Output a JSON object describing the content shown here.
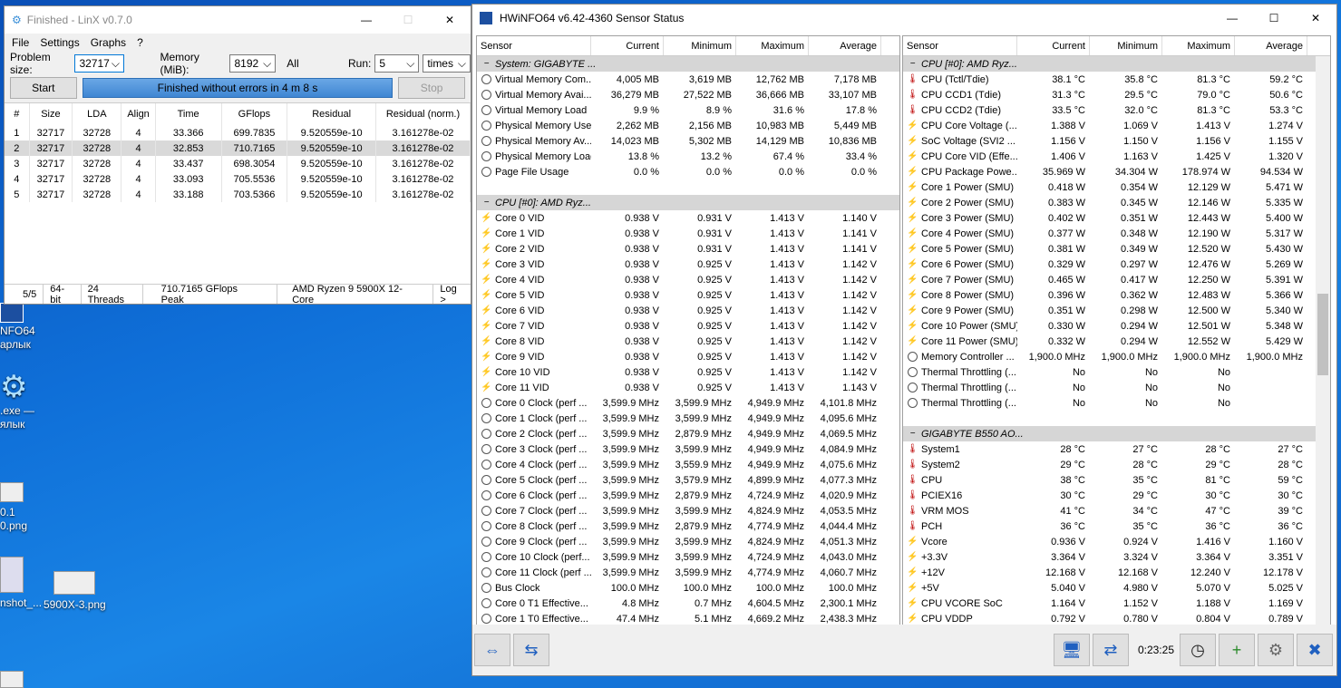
{
  "desktop": {
    "icons": [
      "NFO64",
      "арлык",
      ".exe —",
      "ялык",
      "0.1",
      "0.png",
      "nshot_...",
      "5900X-3.png"
    ]
  },
  "linx": {
    "title": "Finished - LinX v0.7.0",
    "menu": [
      "File",
      "Settings",
      "Graphs",
      "?"
    ],
    "problem_size_label": "Problem size:",
    "problem_size": "32717",
    "memory_label": "Memory (MiB):",
    "memory": "8192",
    "all_label": "All",
    "run_label": "Run:",
    "run": "5",
    "run_unit": "times",
    "start": "Start",
    "progress": "Finished without errors in 4 m 8 s",
    "stop": "Stop",
    "columns": [
      "#",
      "Size",
      "LDA",
      "Align",
      "Time",
      "GFlops",
      "Residual",
      "Residual (norm.)"
    ],
    "rows": [
      [
        "1",
        "32717",
        "32728",
        "4",
        "33.366",
        "699.7835",
        "9.520559e-10",
        "3.161278e-02"
      ],
      [
        "2",
        "32717",
        "32728",
        "4",
        "32.853",
        "710.7165",
        "9.520559e-10",
        "3.161278e-02"
      ],
      [
        "3",
        "32717",
        "32728",
        "4",
        "33.437",
        "698.3054",
        "9.520559e-10",
        "3.161278e-02"
      ],
      [
        "4",
        "32717",
        "32728",
        "4",
        "33.093",
        "705.5536",
        "9.520559e-10",
        "3.161278e-02"
      ],
      [
        "5",
        "32717",
        "32728",
        "4",
        "33.188",
        "703.5366",
        "9.520559e-10",
        "3.161278e-02"
      ]
    ],
    "status": [
      "5/5",
      "64-bit",
      "24 Threads",
      "710.7165 GFlops Peak",
      "AMD Ryzen 9 5900X 12-Core",
      "Log >"
    ]
  },
  "hw": {
    "title": "HWiNFO64 v6.42-4360 Sensor Status",
    "columns": [
      "Sensor",
      "Current",
      "Minimum",
      "Maximum",
      "Average"
    ],
    "left": [
      {
        "g": "System: GIGABYTE ..."
      },
      {
        "i": "clk",
        "n": "Virtual Memory Com...",
        "v": [
          "4,005 MB",
          "3,619 MB",
          "12,762 MB",
          "7,178 MB"
        ]
      },
      {
        "i": "clk",
        "n": "Virtual Memory Avai...",
        "v": [
          "36,279 MB",
          "27,522 MB",
          "36,666 MB",
          "33,107 MB"
        ]
      },
      {
        "i": "clk",
        "n": "Virtual Memory Load",
        "v": [
          "9.9 %",
          "8.9 %",
          "31.6 %",
          "17.8 %"
        ]
      },
      {
        "i": "clk",
        "n": "Physical Memory Used",
        "v": [
          "2,262 MB",
          "2,156 MB",
          "10,983 MB",
          "5,449 MB"
        ]
      },
      {
        "i": "clk",
        "n": "Physical Memory Av...",
        "v": [
          "14,023 MB",
          "5,302 MB",
          "14,129 MB",
          "10,836 MB"
        ]
      },
      {
        "i": "clk",
        "n": "Physical Memory Load",
        "v": [
          "13.8 %",
          "13.2 %",
          "67.4 %",
          "33.4 %"
        ]
      },
      {
        "i": "clk",
        "n": "Page File Usage",
        "v": [
          "0.0 %",
          "0.0 %",
          "0.0 %",
          "0.0 %"
        ]
      },
      {
        "blank": true
      },
      {
        "g": "CPU [#0]: AMD Ryz..."
      },
      {
        "i": "bolt",
        "n": "Core 0 VID",
        "v": [
          "0.938 V",
          "0.931 V",
          "1.413 V",
          "1.140 V"
        ]
      },
      {
        "i": "bolt",
        "n": "Core 1 VID",
        "v": [
          "0.938 V",
          "0.931 V",
          "1.413 V",
          "1.141 V"
        ]
      },
      {
        "i": "bolt",
        "n": "Core 2 VID",
        "v": [
          "0.938 V",
          "0.931 V",
          "1.413 V",
          "1.141 V"
        ]
      },
      {
        "i": "bolt",
        "n": "Core 3 VID",
        "v": [
          "0.938 V",
          "0.925 V",
          "1.413 V",
          "1.142 V"
        ]
      },
      {
        "i": "bolt",
        "n": "Core 4 VID",
        "v": [
          "0.938 V",
          "0.925 V",
          "1.413 V",
          "1.142 V"
        ]
      },
      {
        "i": "bolt",
        "n": "Core 5 VID",
        "v": [
          "0.938 V",
          "0.925 V",
          "1.413 V",
          "1.142 V"
        ]
      },
      {
        "i": "bolt",
        "n": "Core 6 VID",
        "v": [
          "0.938 V",
          "0.925 V",
          "1.413 V",
          "1.142 V"
        ]
      },
      {
        "i": "bolt",
        "n": "Core 7 VID",
        "v": [
          "0.938 V",
          "0.925 V",
          "1.413 V",
          "1.142 V"
        ]
      },
      {
        "i": "bolt",
        "n": "Core 8 VID",
        "v": [
          "0.938 V",
          "0.925 V",
          "1.413 V",
          "1.142 V"
        ]
      },
      {
        "i": "bolt",
        "n": "Core 9 VID",
        "v": [
          "0.938 V",
          "0.925 V",
          "1.413 V",
          "1.142 V"
        ]
      },
      {
        "i": "bolt",
        "n": "Core 10 VID",
        "v": [
          "0.938 V",
          "0.925 V",
          "1.413 V",
          "1.142 V"
        ]
      },
      {
        "i": "bolt",
        "n": "Core 11 VID",
        "v": [
          "0.938 V",
          "0.925 V",
          "1.413 V",
          "1.143 V"
        ]
      },
      {
        "i": "clk",
        "n": "Core 0 Clock (perf ...",
        "v": [
          "3,599.9 MHz",
          "3,599.9 MHz",
          "4,949.9 MHz",
          "4,101.8 MHz"
        ]
      },
      {
        "i": "clk",
        "n": "Core 1 Clock (perf ...",
        "v": [
          "3,599.9 MHz",
          "3,599.9 MHz",
          "4,949.9 MHz",
          "4,095.6 MHz"
        ]
      },
      {
        "i": "clk",
        "n": "Core 2 Clock (perf ...",
        "v": [
          "3,599.9 MHz",
          "2,879.9 MHz",
          "4,949.9 MHz",
          "4,069.5 MHz"
        ]
      },
      {
        "i": "clk",
        "n": "Core 3 Clock (perf ...",
        "v": [
          "3,599.9 MHz",
          "3,599.9 MHz",
          "4,949.9 MHz",
          "4,084.9 MHz"
        ]
      },
      {
        "i": "clk",
        "n": "Core 4 Clock (perf ...",
        "v": [
          "3,599.9 MHz",
          "3,559.9 MHz",
          "4,949.9 MHz",
          "4,075.6 MHz"
        ]
      },
      {
        "i": "clk",
        "n": "Core 5 Clock (perf ...",
        "v": [
          "3,599.9 MHz",
          "3,579.9 MHz",
          "4,899.9 MHz",
          "4,077.3 MHz"
        ]
      },
      {
        "i": "clk",
        "n": "Core 6 Clock (perf ...",
        "v": [
          "3,599.9 MHz",
          "2,879.9 MHz",
          "4,724.9 MHz",
          "4,020.9 MHz"
        ]
      },
      {
        "i": "clk",
        "n": "Core 7 Clock (perf ...",
        "v": [
          "3,599.9 MHz",
          "3,599.9 MHz",
          "4,824.9 MHz",
          "4,053.5 MHz"
        ]
      },
      {
        "i": "clk",
        "n": "Core 8 Clock (perf ...",
        "v": [
          "3,599.9 MHz",
          "2,879.9 MHz",
          "4,774.9 MHz",
          "4,044.4 MHz"
        ]
      },
      {
        "i": "clk",
        "n": "Core 9 Clock (perf ...",
        "v": [
          "3,599.9 MHz",
          "3,599.9 MHz",
          "4,824.9 MHz",
          "4,051.3 MHz"
        ]
      },
      {
        "i": "clk",
        "n": "Core 10 Clock (perf...",
        "v": [
          "3,599.9 MHz",
          "3,599.9 MHz",
          "4,724.9 MHz",
          "4,043.0 MHz"
        ]
      },
      {
        "i": "clk",
        "n": "Core 11 Clock (perf ...",
        "v": [
          "3,599.9 MHz",
          "3,599.9 MHz",
          "4,774.9 MHz",
          "4,060.7 MHz"
        ]
      },
      {
        "i": "clk",
        "n": "Bus Clock",
        "v": [
          "100.0 MHz",
          "100.0 MHz",
          "100.0 MHz",
          "100.0 MHz"
        ]
      },
      {
        "i": "clk",
        "n": "Core 0 T1 Effective...",
        "v": [
          "4.8 MHz",
          "0.7 MHz",
          "4,604.5 MHz",
          "2,300.1 MHz"
        ]
      },
      {
        "i": "clk",
        "n": "Core 1 T0 Effective...",
        "v": [
          "47.4 MHz",
          "5.1 MHz",
          "4,669.2 MHz",
          "2,438.3 MHz"
        ]
      }
    ],
    "right": [
      {
        "g": "CPU [#0]: AMD Ryz..."
      },
      {
        "i": "therm",
        "n": "CPU (Tctl/Tdie)",
        "v": [
          "38.1 °C",
          "35.8 °C",
          "81.3 °C",
          "59.2 °C"
        ]
      },
      {
        "i": "therm",
        "n": "CPU CCD1 (Tdie)",
        "v": [
          "31.3 °C",
          "29.5 °C",
          "79.0 °C",
          "50.6 °C"
        ]
      },
      {
        "i": "therm",
        "n": "CPU CCD2 (Tdie)",
        "v": [
          "33.5 °C",
          "32.0 °C",
          "81.3 °C",
          "53.3 °C"
        ]
      },
      {
        "i": "bolt",
        "n": "CPU Core Voltage (...",
        "v": [
          "1.388 V",
          "1.069 V",
          "1.413 V",
          "1.274 V"
        ]
      },
      {
        "i": "bolt",
        "n": "SoC Voltage (SVI2 ...",
        "v": [
          "1.156 V",
          "1.150 V",
          "1.156 V",
          "1.155 V"
        ]
      },
      {
        "i": "bolt",
        "n": "CPU Core VID (Effe...",
        "v": [
          "1.406 V",
          "1.163 V",
          "1.425 V",
          "1.320 V"
        ]
      },
      {
        "i": "bolt",
        "n": "CPU Package Powe...",
        "v": [
          "35.969 W",
          "34.304 W",
          "178.974 W",
          "94.534 W"
        ]
      },
      {
        "i": "bolt",
        "n": "Core 1 Power (SMU)",
        "v": [
          "0.418 W",
          "0.354 W",
          "12.129 W",
          "5.471 W"
        ]
      },
      {
        "i": "bolt",
        "n": "Core 2 Power (SMU)",
        "v": [
          "0.383 W",
          "0.345 W",
          "12.146 W",
          "5.335 W"
        ]
      },
      {
        "i": "bolt",
        "n": "Core 3 Power (SMU)",
        "v": [
          "0.402 W",
          "0.351 W",
          "12.443 W",
          "5.400 W"
        ]
      },
      {
        "i": "bolt",
        "n": "Core 4 Power (SMU)",
        "v": [
          "0.377 W",
          "0.348 W",
          "12.190 W",
          "5.317 W"
        ]
      },
      {
        "i": "bolt",
        "n": "Core 5 Power (SMU)",
        "v": [
          "0.381 W",
          "0.349 W",
          "12.520 W",
          "5.430 W"
        ]
      },
      {
        "i": "bolt",
        "n": "Core 6 Power (SMU)",
        "v": [
          "0.329 W",
          "0.297 W",
          "12.476 W",
          "5.269 W"
        ]
      },
      {
        "i": "bolt",
        "n": "Core 7 Power (SMU)",
        "v": [
          "0.465 W",
          "0.417 W",
          "12.250 W",
          "5.391 W"
        ]
      },
      {
        "i": "bolt",
        "n": "Core 8 Power (SMU)",
        "v": [
          "0.396 W",
          "0.362 W",
          "12.483 W",
          "5.366 W"
        ]
      },
      {
        "i": "bolt",
        "n": "Core 9 Power (SMU)",
        "v": [
          "0.351 W",
          "0.298 W",
          "12.500 W",
          "5.340 W"
        ]
      },
      {
        "i": "bolt",
        "n": "Core 10 Power (SMU)",
        "v": [
          "0.330 W",
          "0.294 W",
          "12.501 W",
          "5.348 W"
        ]
      },
      {
        "i": "bolt",
        "n": "Core 11 Power (SMU)",
        "v": [
          "0.332 W",
          "0.294 W",
          "12.552 W",
          "5.429 W"
        ]
      },
      {
        "i": "clk",
        "n": "Memory Controller ...",
        "v": [
          "1,900.0 MHz",
          "1,900.0 MHz",
          "1,900.0 MHz",
          "1,900.0 MHz"
        ]
      },
      {
        "i": "clk",
        "n": "Thermal Throttling (...",
        "v": [
          "No",
          "No",
          "No",
          ""
        ]
      },
      {
        "i": "clk",
        "n": "Thermal Throttling (...",
        "v": [
          "No",
          "No",
          "No",
          ""
        ]
      },
      {
        "i": "clk",
        "n": "Thermal Throttling (...",
        "v": [
          "No",
          "No",
          "No",
          ""
        ]
      },
      {
        "blank": true
      },
      {
        "g": "GIGABYTE B550 AO..."
      },
      {
        "i": "therm",
        "n": "System1",
        "v": [
          "28 °C",
          "27 °C",
          "28 °C",
          "27 °C"
        ]
      },
      {
        "i": "therm",
        "n": "System2",
        "v": [
          "29 °C",
          "28 °C",
          "29 °C",
          "28 °C"
        ]
      },
      {
        "i": "therm",
        "n": "CPU",
        "v": [
          "38 °C",
          "35 °C",
          "81 °C",
          "59 °C"
        ]
      },
      {
        "i": "therm",
        "n": "PCIEX16",
        "v": [
          "30 °C",
          "29 °C",
          "30 °C",
          "30 °C"
        ]
      },
      {
        "i": "therm",
        "n": "VRM MOS",
        "v": [
          "41 °C",
          "34 °C",
          "47 °C",
          "39 °C"
        ]
      },
      {
        "i": "therm",
        "n": "PCH",
        "v": [
          "36 °C",
          "35 °C",
          "36 °C",
          "36 °C"
        ]
      },
      {
        "i": "bolt",
        "n": "Vcore",
        "v": [
          "0.936 V",
          "0.924 V",
          "1.416 V",
          "1.160 V"
        ]
      },
      {
        "i": "bolt",
        "n": "+3.3V",
        "v": [
          "3.364 V",
          "3.324 V",
          "3.364 V",
          "3.351 V"
        ]
      },
      {
        "i": "bolt",
        "n": "+12V",
        "v": [
          "12.168 V",
          "12.168 V",
          "12.240 V",
          "12.178 V"
        ]
      },
      {
        "i": "bolt",
        "n": "+5V",
        "v": [
          "5.040 V",
          "4.980 V",
          "5.070 V",
          "5.025 V"
        ]
      },
      {
        "i": "bolt",
        "n": "CPU VCORE SoC",
        "v": [
          "1.164 V",
          "1.152 V",
          "1.188 V",
          "1.169 V"
        ]
      },
      {
        "i": "bolt",
        "n": "CPU VDDP",
        "v": [
          "0.792 V",
          "0.780 V",
          "0.804 V",
          "0.789 V"
        ]
      }
    ],
    "timer": "0:23:25"
  }
}
